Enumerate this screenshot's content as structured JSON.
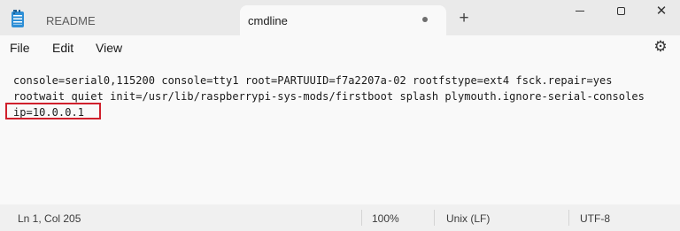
{
  "tabs": [
    {
      "label": "README",
      "active": false
    },
    {
      "label": "cmdline",
      "active": true,
      "unsaved": true
    }
  ],
  "new_tab_glyph": "+",
  "window_controls": {
    "minimize": "",
    "maximize": "",
    "close": "✕"
  },
  "menu": {
    "file": "File",
    "edit": "Edit",
    "view": "View",
    "settings_icon": "⚙"
  },
  "editor": {
    "lines": [
      "console=serial0,115200 console=tty1 root=PARTUUID=f7a2207a-02 rootfstype=ext4 fsck.repair=yes",
      "rootwait quiet init=/usr/lib/raspberrypi-sys-mods/firstboot splash plymouth.ignore-serial-consoles",
      "ip=10.0.0.1"
    ],
    "highlight_color": "#d0202c"
  },
  "status": {
    "position": "Ln 1, Col 205",
    "zoom": "100%",
    "line_ending": "Unix (LF)",
    "encoding": "UTF-8"
  },
  "icons": [
    "notepad-icon",
    "unsaved-dot-icon",
    "plus-icon",
    "minimize-icon",
    "maximize-icon",
    "close-icon",
    "gear-icon"
  ]
}
